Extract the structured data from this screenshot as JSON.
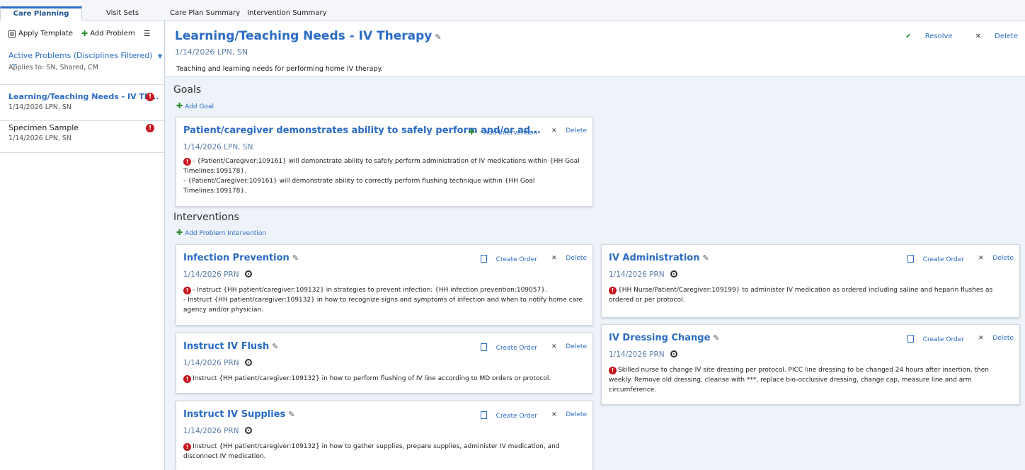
{
  "tabs": [
    {
      "label": "Care Planning",
      "active": true
    },
    {
      "label": "Visit Sets"
    },
    {
      "label": "Care Plan Summary"
    },
    {
      "label": "Intervention Summary"
    }
  ],
  "left_toolbar": {
    "apply_template": "Apply Template",
    "add_problem": "Add Problem"
  },
  "filter": {
    "title": "Active Problems (Disciplines Filtered)",
    "applies_to": "Applies to: SN, Shared, CM"
  },
  "problems": [
    {
      "title": "Learning/Teaching Needs - IV Th...",
      "sub": "1/14/2026   LPN, SN",
      "alert": "!"
    },
    {
      "title": "Specimen Sample",
      "sub": "1/14/2026   LPN, SN",
      "alert": "!"
    }
  ],
  "header": {
    "title": "Learning/Teaching Needs - IV Therapy",
    "date_line": "1/14/2026   LPN, SN",
    "description": "Teaching and learning needs for performing home IV therapy.",
    "resolve_label": "Resolve",
    "delete_label": "Delete"
  },
  "goals": {
    "section_title": "Goals",
    "add_label": "Add Goal",
    "items": [
      {
        "title": "Patient/caregiver demonstrates ability to safely perform and/or ad...",
        "date_line": "1/14/2026   LPN, SN",
        "add_intervention_label": "Add Intervention",
        "delete_label": "Delete",
        "line1": "- {Patient/Caregiver:109161} will demonstrate ability to safely perform administration of IV medications within {HH Goal Timelines:109178}.",
        "line2": "- {Patient/Caregiver:109161} will demonstrate ability to correctly perform flushing technique within {HH Goal Timelines:109178}."
      }
    ]
  },
  "interventions": {
    "section_title": "Interventions",
    "add_label": "Add Problem Intervention",
    "create_order_label": "Create Order",
    "delete_label": "Delete",
    "items": [
      {
        "title": "Infection Prevention",
        "date_line": "1/14/2026   PRN",
        "line1": "- Instruct {HH patient/caregiver:109132} in strategies to prevent infection: {HH infection prevention:109057}.",
        "line2": "- Instruct {HH patient/caregiver:109132} in how to recognize signs and symptoms of infection and when to notify home care agency and/or physician."
      },
      {
        "title": "Instruct IV Flush",
        "date_line": "1/14/2026   PRN",
        "line1": "Instruct {HH patient/caregiver:109132} in how to perform flushing of IV line according to MD orders or protocol."
      },
      {
        "title": "Instruct IV Supplies",
        "date_line": "1/14/2026   PRN",
        "line1": "Instruct {HH patient/caregiver:109132} in how to gather supplies, prepare supplies, administer IV medication, and disconnect IV medication."
      },
      {
        "title": "IV Administration",
        "date_line": "1/14/2026   PRN",
        "line1": "{HH Nurse/Patient/Caregiver:109199} to administer IV medication as ordered including saline and heparin flushes as ordered or per protocol."
      },
      {
        "title": "IV Dressing Change",
        "date_line": "1/14/2026   PRN",
        "line1": "Skilled nurse to change IV site dressing per protocol. PICC line dressing to be changed 24 hours after insertion, then weekly. Remove old dressing, cleanse with ***, replace bio-occlusive dressing, change cap, measure line and arm circumference."
      }
    ]
  },
  "colors": {
    "accent": "#2a6cc4",
    "alert": "#c8161d",
    "add_green": "#2e8b2e"
  }
}
